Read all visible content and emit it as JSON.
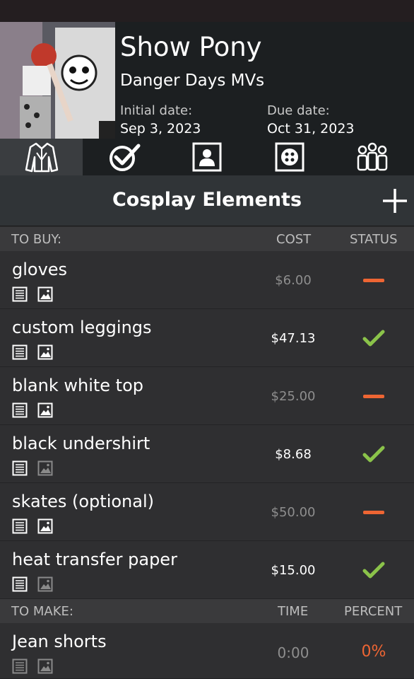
{
  "project": {
    "title": "Show Pony",
    "subtitle": "Danger Days MVs",
    "initial_date_label": "Initial date:",
    "initial_date": "Sep 3, 2023",
    "due_date_label": "Due date:",
    "due_date": "Oct 31, 2023"
  },
  "tabs": [
    {
      "icon": "costume-icon",
      "active": true
    },
    {
      "icon": "checkmark-icon",
      "active": false
    },
    {
      "icon": "portrait-icon",
      "active": false
    },
    {
      "icon": "button-icon",
      "active": false
    },
    {
      "icon": "group-icon",
      "active": false
    }
  ],
  "section": {
    "title": "Cosplay Elements",
    "add_icon": "plus-icon"
  },
  "to_buy": {
    "label": "TO BUY:",
    "col_cost": "COST",
    "col_status": "STATUS",
    "items": [
      {
        "name": "gloves",
        "cost": "$6.00",
        "status": "not-bought",
        "has_image": true
      },
      {
        "name": "custom leggings",
        "cost": "$47.13",
        "status": "bought",
        "has_image": true
      },
      {
        "name": "blank white top",
        "cost": "$25.00",
        "status": "not-bought",
        "has_image": true
      },
      {
        "name": "black undershirt",
        "cost": "$8.68",
        "status": "bought",
        "has_image": false
      },
      {
        "name": "skates (optional)",
        "cost": "$50.00",
        "status": "not-bought",
        "has_image": true
      },
      {
        "name": "heat transfer paper",
        "cost": "$15.00",
        "status": "bought",
        "has_image": false
      }
    ]
  },
  "to_make": {
    "label": "TO MAKE:",
    "col_time": "TIME",
    "col_percent": "PERCENT",
    "items": [
      {
        "name": "Jean shorts",
        "time": "0:00",
        "percent": "0%",
        "has_notes": false,
        "has_image": false
      }
    ]
  },
  "colors": {
    "accent_orange": "#ee6533",
    "accent_green": "#8bc34a",
    "background": "#2f2f31",
    "header": "#1c1f21"
  }
}
